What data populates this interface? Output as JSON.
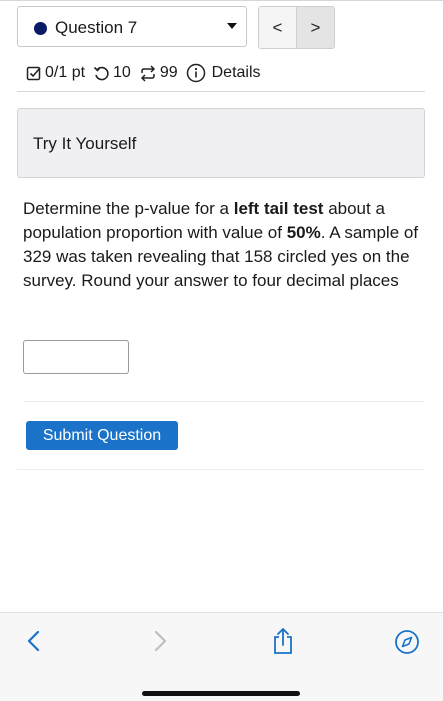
{
  "header": {
    "question_label": "Question 7",
    "prev_glyph": "<",
    "next_glyph": ">"
  },
  "meta": {
    "score": "0/1 pt",
    "retries": "10",
    "attempts": "99",
    "details": "Details"
  },
  "try_it": {
    "title": "Try It Yourself"
  },
  "problem": {
    "t1": "Determine the p-value for a ",
    "b1": "left tail test",
    "t2": " about a population proportion with value of ",
    "b2": "50%",
    "t3": ". A sample of 329 was taken revealing that 158 circled yes on the survey. Round your answer to four decimal places"
  },
  "answer": {
    "value": ""
  },
  "submit": {
    "label": "Submit Question"
  },
  "colors": {
    "accent": "#1a73c9",
    "dot": "#0a1a66"
  },
  "toolbar": {
    "icons": [
      "back-icon",
      "forward-icon",
      "share-icon",
      "compass-icon"
    ]
  }
}
